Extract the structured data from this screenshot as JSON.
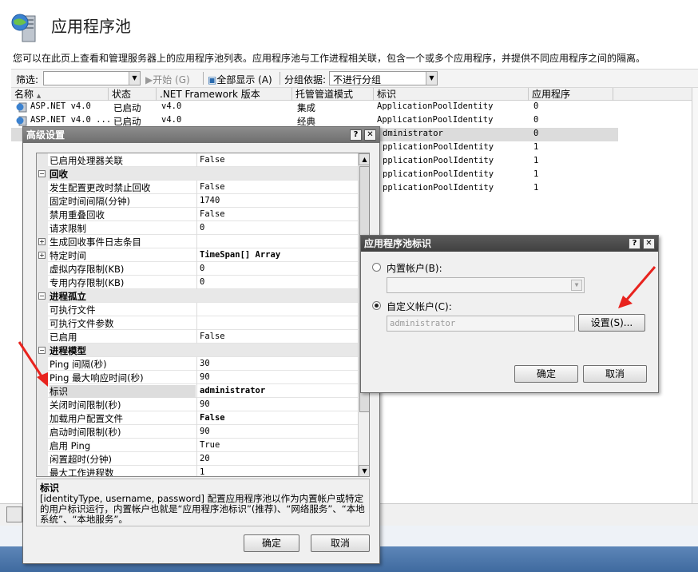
{
  "page": {
    "title": "应用程序池",
    "description": "您可以在此页上查看和管理服务器上的应用程序池列表。应用程序池与工作进程相关联，包含一个或多个应用程序，并提供不同应用程序之间的隔离。"
  },
  "filter_bar": {
    "filter_label": "筛选:",
    "start_label": "开始 (G)",
    "show_all_label": "全部显示 (A)",
    "group_by_label": "分组依据:",
    "group_by_value": "不进行分组"
  },
  "grid": {
    "columns": [
      "名称",
      "状态",
      ".NET Framework 版本",
      "托管管道模式",
      "标识",
      "应用程序"
    ],
    "rows": [
      {
        "name": "ASP.NET v4.0",
        "status": "已启动",
        "version": "v4.0",
        "mode": "集成",
        "identity": "ApplicationPoolIdentity",
        "apps": "0"
      },
      {
        "name": "ASP.NET v4.0 ...",
        "status": "已启动",
        "version": "v4.0",
        "mode": "经典",
        "identity": "ApplicationPoolIdentity",
        "apps": "0"
      },
      {
        "identity": "dministrator",
        "apps": "0"
      },
      {
        "identity": "pplicationPoolIdentity",
        "apps": "1"
      },
      {
        "identity": "pplicationPoolIdentity",
        "apps": "1"
      },
      {
        "identity": "pplicationPoolIdentity",
        "apps": "1"
      },
      {
        "identity": "pplicationPoolIdentity",
        "apps": "1"
      }
    ]
  },
  "adv_dialog": {
    "title": "高级设置",
    "help_btn": "?",
    "close_btn": "✕",
    "rows": [
      {
        "name": "已启用处理器关联",
        "value": "False"
      },
      {
        "name": "回收",
        "value": "",
        "cat": true
      },
      {
        "name": "发生配置更改时禁止回收",
        "value": "False"
      },
      {
        "name": "固定时间间隔(分钟)",
        "value": "1740"
      },
      {
        "name": "禁用重叠回收",
        "value": "False"
      },
      {
        "name": "请求限制",
        "value": "0"
      },
      {
        "name": "生成回收事件日志条目",
        "value": "",
        "plus": true
      },
      {
        "name": "特定时间",
        "value": "TimeSpan[] Array",
        "plus": true,
        "bold": true
      },
      {
        "name": "虚拟内存限制(KB)",
        "value": "0"
      },
      {
        "name": "专用内存限制(KB)",
        "value": "0"
      },
      {
        "name": "进程孤立",
        "value": "",
        "cat": true
      },
      {
        "name": "可执行文件",
        "value": ""
      },
      {
        "name": "可执行文件参数",
        "value": ""
      },
      {
        "name": "已启用",
        "value": "False"
      },
      {
        "name": "进程模型",
        "value": "",
        "cat": true
      },
      {
        "name": "Ping 间隔(秒)",
        "value": "30"
      },
      {
        "name": "Ping 最大响应时间(秒)",
        "value": "90"
      },
      {
        "name": "标识",
        "value": "administrator",
        "sel": true,
        "bold": true
      },
      {
        "name": "关闭时间限制(秒)",
        "value": "90"
      },
      {
        "name": "加载用户配置文件",
        "value": "False",
        "bold": true
      },
      {
        "name": "启动时间限制(秒)",
        "value": "90"
      },
      {
        "name": "启用 Ping",
        "value": "True"
      },
      {
        "name": "闲置超时(分钟)",
        "value": "20"
      },
      {
        "name": "最大工作进程数",
        "value": "1"
      }
    ],
    "desc_title": "标识",
    "desc_body": "[identityType, username, password] 配置应用程序池以作为内置帐户或特定的用户标识运行，内置帐户也就是“应用程序池标识”(推荐)、“网络服务”、“本地系统”、“本地服务”。",
    "ok_label": "确定",
    "cancel_label": "取消"
  },
  "id_dialog": {
    "title": "应用程序池标识",
    "help_btn": "?",
    "close_btn": "✕",
    "builtin_label": "内置帐户(B):",
    "custom_label": "自定义帐户(C):",
    "custom_value": "administrator",
    "set_label": "设置(S)...",
    "ok_label": "确定",
    "cancel_label": "取消"
  },
  "colors": {
    "arrow": "#e8231e",
    "taskbar": "#4a75aa"
  }
}
